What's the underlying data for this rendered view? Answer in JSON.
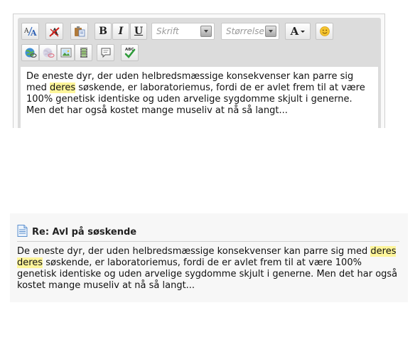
{
  "editor": {
    "toolbar": {
      "font_select": {
        "placeholder": "Skrift"
      },
      "size_select": {
        "placeholder": "Størrelse"
      },
      "bold_label": "B",
      "italic_label": "I",
      "underline_label": "U",
      "font_color_label": "A",
      "icons": [
        "font-style-icon",
        "remove-format-icon",
        "paste-icon",
        "emoticon-icon",
        "link-icon",
        "unlink-icon",
        "image-icon",
        "video-icon",
        "quote-icon",
        "spellcheck-icon"
      ]
    },
    "text": {
      "before": "De eneste dyr, der uden helbredsmæssige konsekvenser kan parre sig med ",
      "highlight": "deres",
      "after": " søskende, er laboratoriemus, fordi de er avlet frem til at være 100% genetisk identiske og uden arvelige sygdomme skjult i generne. Men det har også kostet mange museliv at nå så langt...",
      "highlight_color": "#fef59a"
    }
  },
  "post": {
    "icon": "document-icon",
    "title": "Re: Avl på søskende",
    "text": {
      "before": "De eneste dyr, der uden helbredsmæssige konsekvenser kan parre sig med ",
      "highlight1": "deres",
      "middle": " ",
      "highlight2": "deres",
      "after": " søskende, er laboratoriemus, fordi de er avlet frem til at være 100% genetisk identiske og uden arvelige sygdomme skjult i generne. Men det har også kostet mange museliv at nå så langt..."
    },
    "highlight_color": "#fef59a"
  }
}
